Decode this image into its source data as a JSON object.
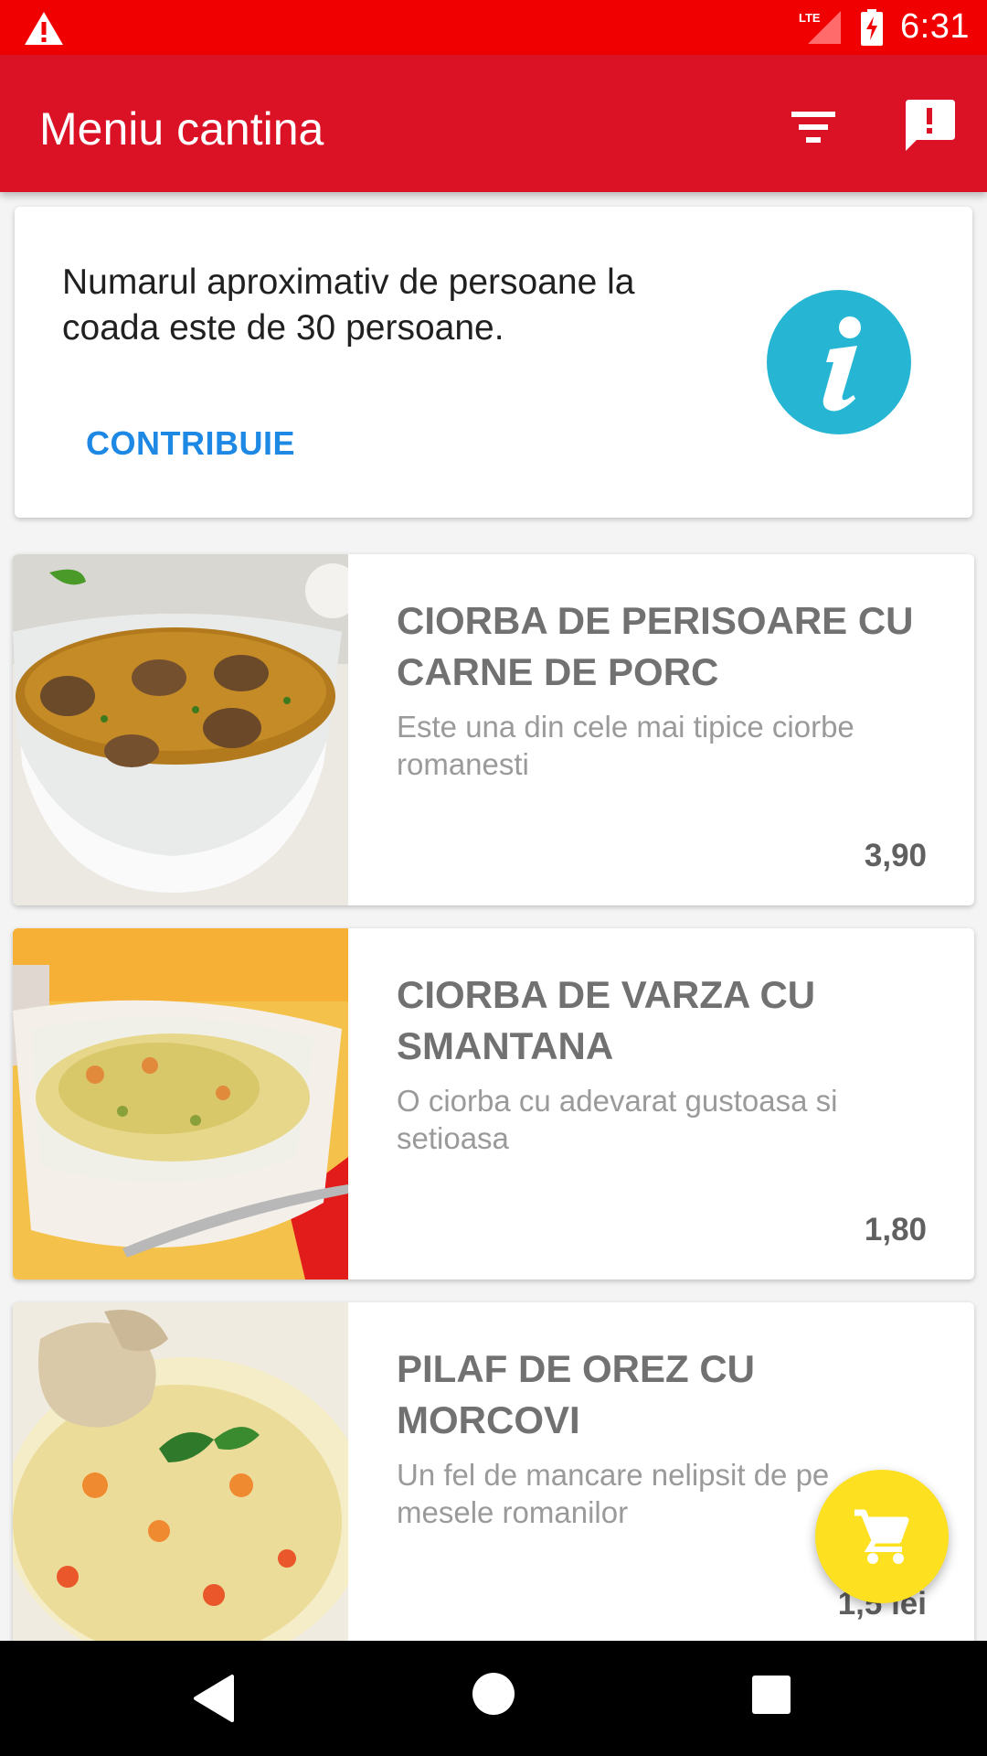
{
  "status_bar": {
    "time": "6:31",
    "network": "LTE",
    "icons": [
      "warning-icon",
      "lte-signal-icon",
      "battery-charging-icon"
    ]
  },
  "app_bar": {
    "title": "Meniu cantina",
    "actions": [
      "filter-icon",
      "feedback-icon"
    ]
  },
  "info_card": {
    "text": "Numarul aproximativ de persoane la coada este de 30 persoane.",
    "action_label": "CONTRIBUIE",
    "icon": "info-icon"
  },
  "menu": {
    "items": [
      {
        "name": "CIORBA DE PERISOARE CU CARNE DE PORC",
        "description": "Este una din cele mai tipice ciorbe romanesti",
        "price": "3,90"
      },
      {
        "name": "CIORBA DE VARZA CU SMANTANA",
        "description": "O ciorba cu adevarat gustoasa si setioasa",
        "price": "1,80"
      },
      {
        "name": "PILAF DE OREZ CU MORCOVI",
        "description": "Un fel de mancare nelipsit de pe mesele romanilor",
        "price": "1,5 lei"
      }
    ]
  },
  "fab": {
    "icon": "cart-icon"
  },
  "nav_bar": {
    "buttons": [
      "back-icon",
      "home-icon",
      "recents-icon"
    ]
  },
  "colors": {
    "status_bar": "#f00000",
    "app_bar": "#db1125",
    "accent_link": "#1e88e5",
    "info_icon": "#26b6d4",
    "fab": "#fde020"
  }
}
